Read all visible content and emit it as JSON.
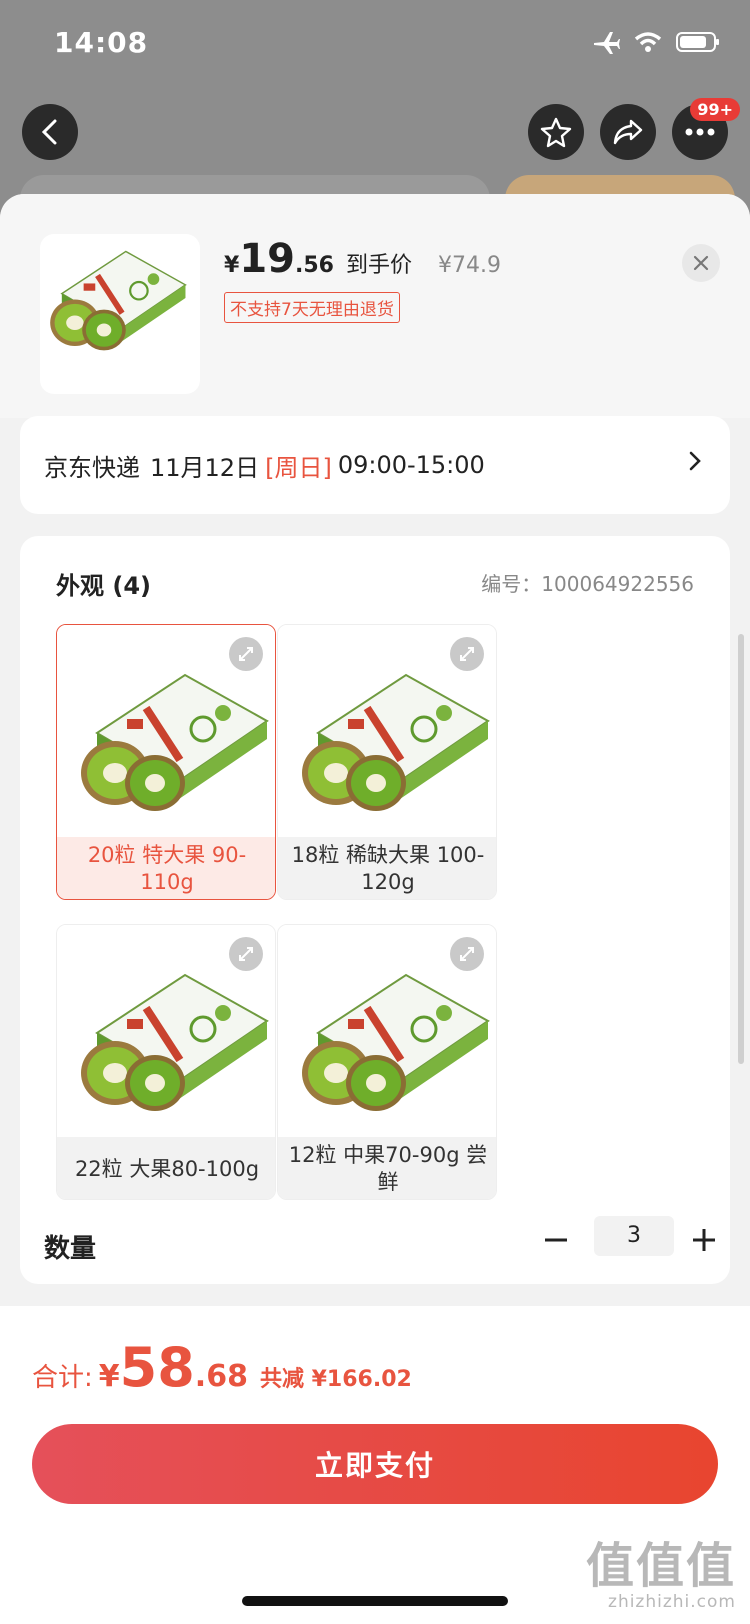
{
  "status_bar": {
    "time": "14:08"
  },
  "top_bar": {
    "more_badge": "99+"
  },
  "product": {
    "currency": "¥",
    "price_int": "19",
    "price_dec": ".56",
    "price_label": "到手价",
    "original_price": "¥74.9",
    "return_tag": "不支持7天无理由退货"
  },
  "delivery": {
    "carrier": "京东快递",
    "date": "11月12日",
    "weekday": "[周日]",
    "time_window": "09:00-15:00"
  },
  "variants": {
    "title": "外观 (4)",
    "sku_label": "编号：",
    "sku_number": "100064922556",
    "options": [
      {
        "label": "20粒 特大果 90-110g",
        "selected": true
      },
      {
        "label": "18粒 稀缺大果 100-120g",
        "selected": false
      },
      {
        "label": "22粒 大果80-100g",
        "selected": false
      },
      {
        "label": "12粒 中果70-90g 尝鲜",
        "selected": false
      }
    ]
  },
  "quantity": {
    "label": "数量",
    "value": "3"
  },
  "footer": {
    "total_label": "合计:",
    "currency": "¥",
    "total_int": "58",
    "total_dec": ".68",
    "saved": "共减 ¥166.02",
    "pay_label": "立即支付"
  },
  "watermark": {
    "text": "值值值",
    "url": "zhizhizhi.com"
  },
  "colors": {
    "accent": "#e8543f",
    "pay_start": "#e5505a",
    "pay_end": "#e8452f"
  }
}
